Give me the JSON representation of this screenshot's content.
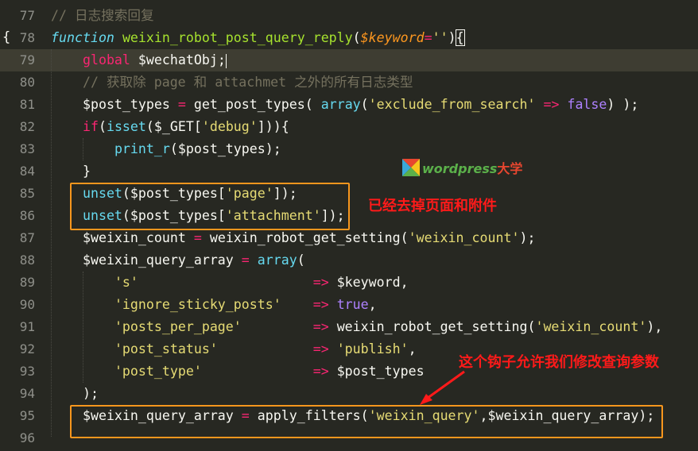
{
  "editor": {
    "fold_marker": "{",
    "lines": [
      {
        "num": "77",
        "tokens": [
          {
            "t": "comment",
            "v": "// 日志搜索回复"
          }
        ]
      },
      {
        "num": "78",
        "tokens": [
          {
            "t": "store",
            "v": "function"
          },
          {
            "t": "plain",
            "v": " "
          },
          {
            "t": "func",
            "v": "weixin_robot_post_query_reply"
          },
          {
            "t": "plain",
            "v": "("
          },
          {
            "t": "param",
            "v": "$keyword"
          },
          {
            "t": "kw",
            "v": "="
          },
          {
            "t": "str",
            "v": "''"
          },
          {
            "t": "plain",
            "v": ")"
          },
          {
            "t": "brace",
            "v": "{"
          }
        ]
      },
      {
        "num": "79",
        "active": true,
        "tokens": [
          {
            "t": "indent",
            "v": "    "
          },
          {
            "t": "kw",
            "v": "global"
          },
          {
            "t": "plain",
            "v": " "
          },
          {
            "t": "var",
            "v": "$wechatObj"
          },
          {
            "t": "plain",
            "v": ";"
          },
          {
            "t": "cursor",
            "v": ""
          }
        ]
      },
      {
        "num": "80",
        "tokens": [
          {
            "t": "indent",
            "v": "    "
          },
          {
            "t": "comment",
            "v": "// 获取除 page 和 attachmet 之外的所有日志类型"
          }
        ]
      },
      {
        "num": "81",
        "tokens": [
          {
            "t": "indent",
            "v": "    "
          },
          {
            "t": "var",
            "v": "$post_types"
          },
          {
            "t": "plain",
            "v": " "
          },
          {
            "t": "kw",
            "v": "="
          },
          {
            "t": "plain",
            "v": " get_post_types( "
          },
          {
            "t": "builtin",
            "v": "array"
          },
          {
            "t": "plain",
            "v": "("
          },
          {
            "t": "str",
            "v": "'exclude_from_search'"
          },
          {
            "t": "plain",
            "v": " "
          },
          {
            "t": "kw",
            "v": "=>"
          },
          {
            "t": "plain",
            "v": " "
          },
          {
            "t": "const",
            "v": "false"
          },
          {
            "t": "plain",
            "v": ") );"
          }
        ]
      },
      {
        "num": "82",
        "tokens": [
          {
            "t": "indent",
            "v": "    "
          },
          {
            "t": "kw",
            "v": "if"
          },
          {
            "t": "plain",
            "v": "("
          },
          {
            "t": "builtin",
            "v": "isset"
          },
          {
            "t": "plain",
            "v": "($_GET["
          },
          {
            "t": "str",
            "v": "'debug'"
          },
          {
            "t": "plain",
            "v": "])){"
          }
        ]
      },
      {
        "num": "83",
        "tokens": [
          {
            "t": "indent",
            "v": "        "
          },
          {
            "t": "builtin",
            "v": "print_r"
          },
          {
            "t": "plain",
            "v": "($post_types);"
          }
        ]
      },
      {
        "num": "84",
        "tokens": [
          {
            "t": "indent",
            "v": "    "
          },
          {
            "t": "plain",
            "v": "}"
          }
        ]
      },
      {
        "num": "85",
        "tokens": [
          {
            "t": "indent",
            "v": "    "
          },
          {
            "t": "builtin",
            "v": "unset"
          },
          {
            "t": "plain",
            "v": "($post_types["
          },
          {
            "t": "str",
            "v": "'page'"
          },
          {
            "t": "plain",
            "v": "]);"
          }
        ]
      },
      {
        "num": "86",
        "tokens": [
          {
            "t": "indent",
            "v": "    "
          },
          {
            "t": "builtin",
            "v": "unset"
          },
          {
            "t": "plain",
            "v": "($post_types["
          },
          {
            "t": "str",
            "v": "'attachment'"
          },
          {
            "t": "plain",
            "v": "]);"
          }
        ]
      },
      {
        "num": "87",
        "tokens": [
          {
            "t": "indent",
            "v": "    "
          },
          {
            "t": "var",
            "v": "$weixin_count"
          },
          {
            "t": "plain",
            "v": " "
          },
          {
            "t": "kw",
            "v": "="
          },
          {
            "t": "plain",
            "v": " weixin_robot_get_setting("
          },
          {
            "t": "str",
            "v": "'weixin_count'"
          },
          {
            "t": "plain",
            "v": ");"
          }
        ]
      },
      {
        "num": "88",
        "tokens": [
          {
            "t": "indent",
            "v": "    "
          },
          {
            "t": "var",
            "v": "$weixin_query_array"
          },
          {
            "t": "plain",
            "v": " "
          },
          {
            "t": "kw",
            "v": "="
          },
          {
            "t": "plain",
            "v": " "
          },
          {
            "t": "builtin",
            "v": "array"
          },
          {
            "t": "plain",
            "v": "("
          }
        ]
      },
      {
        "num": "89",
        "tokens": [
          {
            "t": "indent",
            "v": "        "
          },
          {
            "t": "str",
            "v": "'s'"
          },
          {
            "t": "plain",
            "v": "                      "
          },
          {
            "t": "kw",
            "v": "=>"
          },
          {
            "t": "plain",
            "v": " $keyword,"
          }
        ]
      },
      {
        "num": "90",
        "tokens": [
          {
            "t": "indent",
            "v": "        "
          },
          {
            "t": "str",
            "v": "'ignore_sticky_posts'"
          },
          {
            "t": "plain",
            "v": "    "
          },
          {
            "t": "kw",
            "v": "=>"
          },
          {
            "t": "plain",
            "v": " "
          },
          {
            "t": "const",
            "v": "true"
          },
          {
            "t": "plain",
            "v": ","
          }
        ]
      },
      {
        "num": "91",
        "tokens": [
          {
            "t": "indent",
            "v": "        "
          },
          {
            "t": "str",
            "v": "'posts_per_page'"
          },
          {
            "t": "plain",
            "v": "         "
          },
          {
            "t": "kw",
            "v": "=>"
          },
          {
            "t": "plain",
            "v": " weixin_robot_get_setting("
          },
          {
            "t": "str",
            "v": "'weixin_count'"
          },
          {
            "t": "plain",
            "v": "),"
          }
        ]
      },
      {
        "num": "92",
        "tokens": [
          {
            "t": "indent",
            "v": "        "
          },
          {
            "t": "str",
            "v": "'post_status'"
          },
          {
            "t": "plain",
            "v": "            "
          },
          {
            "t": "kw",
            "v": "=>"
          },
          {
            "t": "plain",
            "v": " "
          },
          {
            "t": "str",
            "v": "'publish'"
          },
          {
            "t": "plain",
            "v": ","
          }
        ]
      },
      {
        "num": "93",
        "tokens": [
          {
            "t": "indent",
            "v": "        "
          },
          {
            "t": "str",
            "v": "'post_type'"
          },
          {
            "t": "plain",
            "v": "              "
          },
          {
            "t": "kw",
            "v": "=>"
          },
          {
            "t": "plain",
            "v": " $post_types"
          }
        ]
      },
      {
        "num": "94",
        "tokens": [
          {
            "t": "indent",
            "v": "    "
          },
          {
            "t": "plain",
            "v": ");"
          }
        ]
      },
      {
        "num": "95",
        "tokens": [
          {
            "t": "indent",
            "v": "    "
          },
          {
            "t": "var",
            "v": "$weixin_query_array"
          },
          {
            "t": "plain",
            "v": " "
          },
          {
            "t": "kw",
            "v": "="
          },
          {
            "t": "plain",
            "v": " apply_filters("
          },
          {
            "t": "str",
            "v": "'weixin_query'"
          },
          {
            "t": "plain",
            "v": ",$weixin_query_array);"
          }
        ]
      },
      {
        "num": "96",
        "tokens": []
      }
    ]
  },
  "annotations": {
    "unset_note": "已经去掉页面和附件",
    "filter_note": "这个钩子允许我们修改查询参数",
    "highlight_color": "#f7961d",
    "note_color": "#ff1a1a"
  },
  "watermark": {
    "logo_icon": "wordpress-daxue-logo-icon",
    "text": "wordpress",
    "text_cn": "大学"
  },
  "theme": {
    "background": "#272822",
    "active_line": "#3e3d32",
    "comment": "#75715e",
    "keyword": "#f92672",
    "function": "#a6e22e",
    "string": "#e6db74",
    "constant": "#ae81ff",
    "builtin": "#66d9ef",
    "parameter": "#fd971f"
  }
}
